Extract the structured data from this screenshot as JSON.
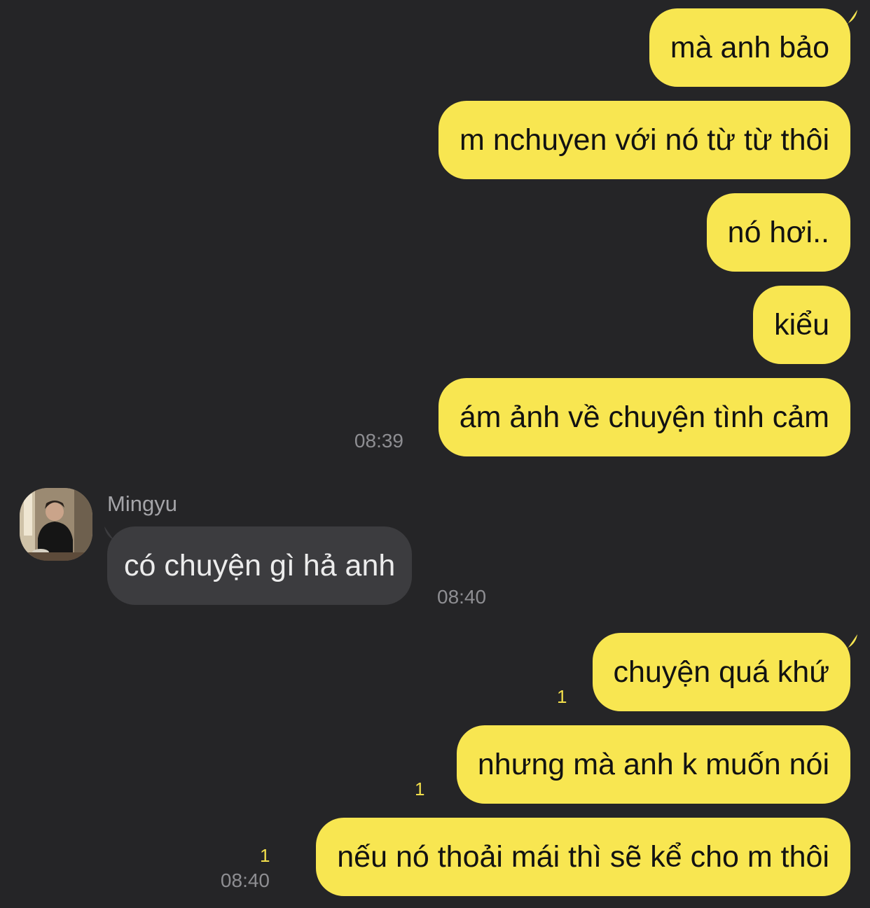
{
  "conversation": {
    "contact_name": "Mingyu",
    "colors": {
      "background": "#252527",
      "outgoing_bubble": "#f8e651",
      "incoming_bubble": "#3c3c3f",
      "unread_count": "#f3df4b"
    },
    "messages": [
      {
        "direction": "outgoing",
        "text": "mà anh bảo"
      },
      {
        "direction": "outgoing",
        "text": "m nchuyen với nó từ từ thôi"
      },
      {
        "direction": "outgoing",
        "text": "nó hơi.."
      },
      {
        "direction": "outgoing",
        "text": "kiểu"
      },
      {
        "direction": "outgoing",
        "text": "ám ảnh về chuyện tình cảm",
        "time": "08:39"
      },
      {
        "direction": "incoming",
        "sender": "Mingyu",
        "avatar_icon": "profile-photo",
        "text": "có chuyện gì hả anh",
        "time": "08:40"
      },
      {
        "direction": "outgoing",
        "text": "chuyện quá khứ",
        "unread": "1"
      },
      {
        "direction": "outgoing",
        "text": "nhưng mà anh k muốn nói",
        "unread": "1"
      },
      {
        "direction": "outgoing",
        "text": "nếu nó thoải mái thì sẽ kể cho m thôi",
        "unread": "1",
        "time": "08:40"
      }
    ]
  }
}
